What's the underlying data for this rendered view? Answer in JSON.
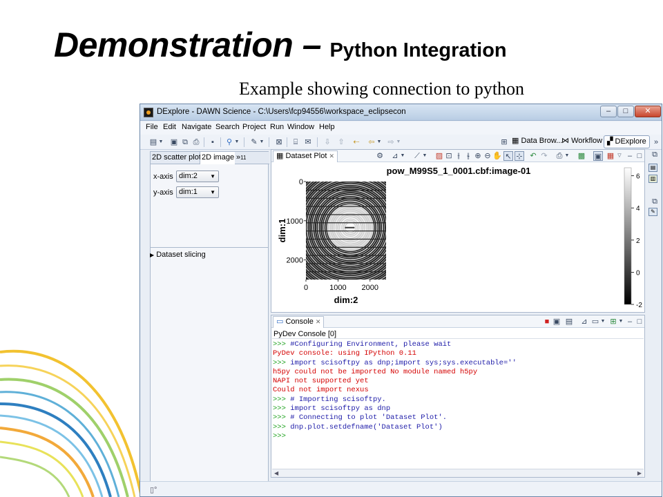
{
  "slide": {
    "title_main": "Demonstration –",
    "title_sub": "Python Integration",
    "subtitle": "Example showing connection to python"
  },
  "window": {
    "title": "DExplore - DAWN Science - C:\\Users\\fcp94556\\workspace_eclipsecon",
    "min_glyph": "–",
    "max_glyph": "□",
    "close_glyph": "✕"
  },
  "menu": [
    "File",
    "Edit",
    "Navigate",
    "Search",
    "Project",
    "Run",
    "Window",
    "Help"
  ],
  "perspectives": {
    "data_browsing": "Data Brow...",
    "workflow": "Workflow",
    "dexplore": "DExplore",
    "more": "»"
  },
  "left_panel": {
    "tabs": [
      "2D scatter plot",
      "2D image"
    ],
    "overflow_tab": "»",
    "overflow_count": "11",
    "x_axis": {
      "label": "x-axis",
      "value": "dim:2"
    },
    "y_axis": {
      "label": "y-axis",
      "value": "dim:1"
    },
    "slicing_label": "Dataset slicing"
  },
  "plot": {
    "tab_label": "Dataset Plot",
    "title": "pow_M99S5_1_0001.cbf:image-01",
    "xlabel": "dim:2",
    "ylabel": "dim:1",
    "colors": {
      "ring": "#ffffff",
      "background": "#1c1c1c"
    }
  },
  "chart_data": {
    "type": "heatmap",
    "title": "pow_M99S5_1_0001.cbf:image-01",
    "xlabel": "dim:2",
    "ylabel": "dim:1",
    "xlim": [
      0,
      2500
    ],
    "ylim": [
      0,
      2500
    ],
    "x_ticks": [
      0,
      1000,
      2000
    ],
    "y_ticks": [
      0,
      1000,
      2000
    ],
    "colorbar": {
      "range": [
        -2,
        6.5
      ],
      "ticks": [
        6,
        4,
        2,
        0,
        -2
      ]
    }
  },
  "console": {
    "tab_label": "Console",
    "sub_label": "PyDev Console [0]",
    "lines": [
      {
        "kind": "in",
        "prompt": ">>> ",
        "text": "#Configuring Environment, please wait"
      },
      {
        "kind": "err",
        "prompt": "",
        "text": "PyDev console: using IPython 0.11"
      },
      {
        "kind": "in",
        "prompt": ">>> ",
        "text": "import scisoftpy as dnp;import sys;sys.executable=''"
      },
      {
        "kind": "err",
        "prompt": "",
        "text": "h5py could not be imported No module named h5py"
      },
      {
        "kind": "err",
        "prompt": "",
        "text": "NAPI not supported yet"
      },
      {
        "kind": "err",
        "prompt": "",
        "text": "Could not import nexus"
      },
      {
        "kind": "in",
        "prompt": ">>> ",
        "text": "# Importing scisoftpy."
      },
      {
        "kind": "in",
        "prompt": ">>> ",
        "text": "import scisoftpy as dnp"
      },
      {
        "kind": "in",
        "prompt": ">>> ",
        "text": "# Connecting to plot 'Dataset Plot'."
      },
      {
        "kind": "in",
        "prompt": ">>> ",
        "text": "dnp.plot.setdefname('Dataset Plot')"
      },
      {
        "kind": "in",
        "prompt": ">>>",
        "text": ""
      }
    ]
  }
}
